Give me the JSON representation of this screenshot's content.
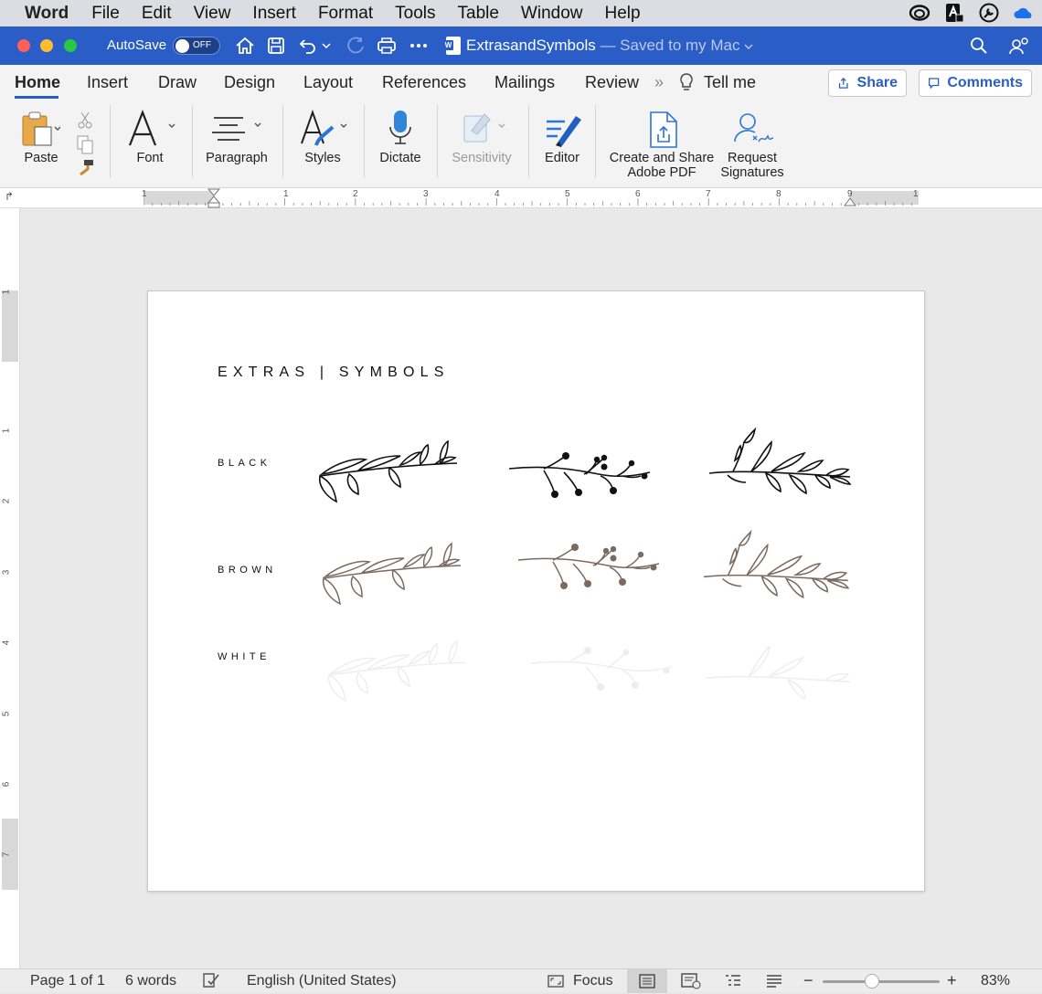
{
  "menubar": {
    "app_name": "Word",
    "items": [
      "File",
      "Edit",
      "View",
      "Insert",
      "Format",
      "Tools",
      "Table",
      "Window",
      "Help"
    ]
  },
  "titlebar": {
    "autosave_label": "AutoSave",
    "autosave_state": "OFF",
    "doc_name": "ExtrasandSymbols",
    "doc_status": " — Saved to my Mac"
  },
  "tabs": {
    "items": [
      "Home",
      "Insert",
      "Draw",
      "Design",
      "Layout",
      "References",
      "Mailings",
      "Review"
    ],
    "more": "»",
    "tell_me": "Tell me",
    "share": "Share",
    "comments": "Comments"
  },
  "ribbon": {
    "paste": "Paste",
    "font": "Font",
    "paragraph": "Paragraph",
    "styles": "Styles",
    "dictate": "Dictate",
    "sensitivity": "Sensitivity",
    "editor": "Editor",
    "create_pdf_line1": "Create and Share",
    "create_pdf_line2": "Adobe PDF",
    "request_line1": "Request",
    "request_line2": "Signatures"
  },
  "ruler": {
    "h_numbers": [
      "1",
      "1",
      "2",
      "3",
      "4",
      "5",
      "6",
      "7",
      "8",
      "9",
      "1"
    ],
    "v_numbers": [
      "1",
      "1",
      "2",
      "3",
      "4",
      "5",
      "6",
      "7"
    ]
  },
  "document": {
    "heading": "EXTRAS | SYMBOLS",
    "rows": [
      {
        "label": "BLACK",
        "color": "#111111"
      },
      {
        "label": "BROWN",
        "color": "#7a6a60"
      },
      {
        "label": "WHITE",
        "color": "#ededed"
      }
    ]
  },
  "statusbar": {
    "page": "Page 1 of 1",
    "words": "6 words",
    "language": "English (United States)",
    "focus": "Focus",
    "zoom_minus": "−",
    "zoom_plus": "+",
    "zoom": "83%",
    "zoom_level": 0.83
  },
  "colors": {
    "accent": "#2b5dc6",
    "titlebar": "#2b5dc6"
  }
}
